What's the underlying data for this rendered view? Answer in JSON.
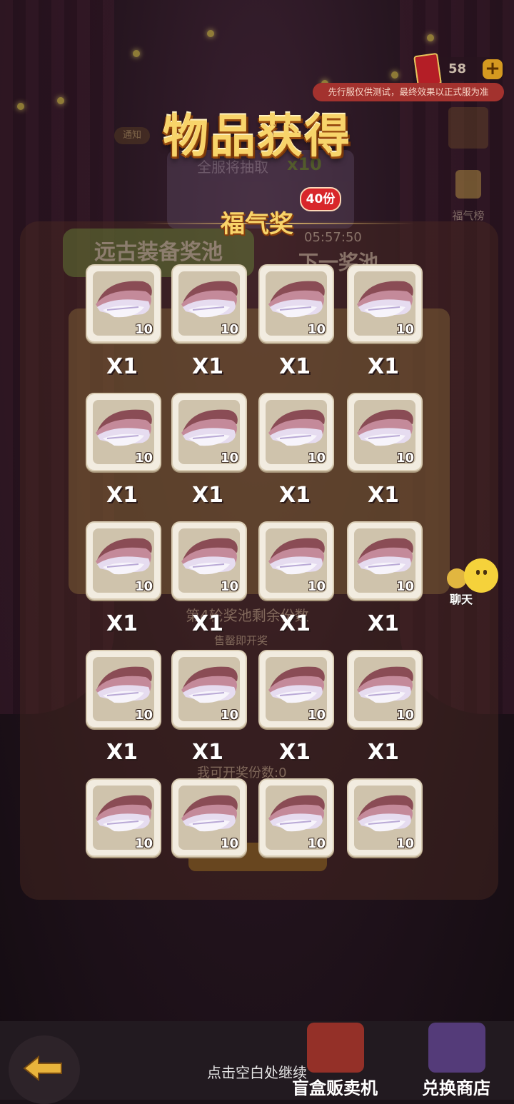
{
  "top_bar": {
    "currency_value": "58",
    "plus_label": "+",
    "test_notice": "先行服仅供测试，最终效果以正式服为准"
  },
  "background": {
    "notice_label": "通知",
    "grand_text": "全服将抽取",
    "grand_mult": "x10",
    "rank_label": "福气榜",
    "pool_tab": "远古装备奖池",
    "next_pool_timer": "05:57:50",
    "next_pool_name": "下一奖池",
    "remaining_label": "第4轮奖池剩余份数",
    "remaining_sub": "售罄即开奖",
    "my_count_label": "我可开奖份数:0"
  },
  "modal": {
    "title": "物品获得",
    "prize_name": "福气奖",
    "prize_count_badge": "40份",
    "items": [
      {
        "icon": "feather-icon",
        "qty": "10",
        "mult": "X1"
      },
      {
        "icon": "feather-icon",
        "qty": "10",
        "mult": "X1"
      },
      {
        "icon": "feather-icon",
        "qty": "10",
        "mult": "X1"
      },
      {
        "icon": "feather-icon",
        "qty": "10",
        "mult": "X1"
      },
      {
        "icon": "feather-icon",
        "qty": "10",
        "mult": "X1"
      },
      {
        "icon": "feather-icon",
        "qty": "10",
        "mult": "X1"
      },
      {
        "icon": "feather-icon",
        "qty": "10",
        "mult": "X1"
      },
      {
        "icon": "feather-icon",
        "qty": "10",
        "mult": "X1"
      },
      {
        "icon": "feather-icon",
        "qty": "10",
        "mult": "X1"
      },
      {
        "icon": "feather-icon",
        "qty": "10",
        "mult": "X1"
      },
      {
        "icon": "feather-icon",
        "qty": "10",
        "mult": "X1"
      },
      {
        "icon": "feather-icon",
        "qty": "10",
        "mult": "X1"
      },
      {
        "icon": "feather-icon",
        "qty": "10",
        "mult": "X1"
      },
      {
        "icon": "feather-icon",
        "qty": "10",
        "mult": "X1"
      },
      {
        "icon": "feather-icon",
        "qty": "10",
        "mult": "X1"
      },
      {
        "icon": "feather-icon",
        "qty": "10",
        "mult": "X1"
      },
      {
        "icon": "feather-icon",
        "qty": "10",
        "mult": ""
      },
      {
        "icon": "feather-icon",
        "qty": "10",
        "mult": ""
      },
      {
        "icon": "feather-icon",
        "qty": "10",
        "mult": ""
      },
      {
        "icon": "feather-icon",
        "qty": "10",
        "mult": ""
      }
    ]
  },
  "chat": {
    "label": "聊天"
  },
  "bottom": {
    "continue_hint": "点击空白处继续",
    "shop1_label": "盲盒贩卖机",
    "shop2_label": "兑换商店"
  },
  "colors": {
    "title_gold": "#f8d46a",
    "badge_red": "#d8262a",
    "card_bg": "#f2ece0"
  }
}
